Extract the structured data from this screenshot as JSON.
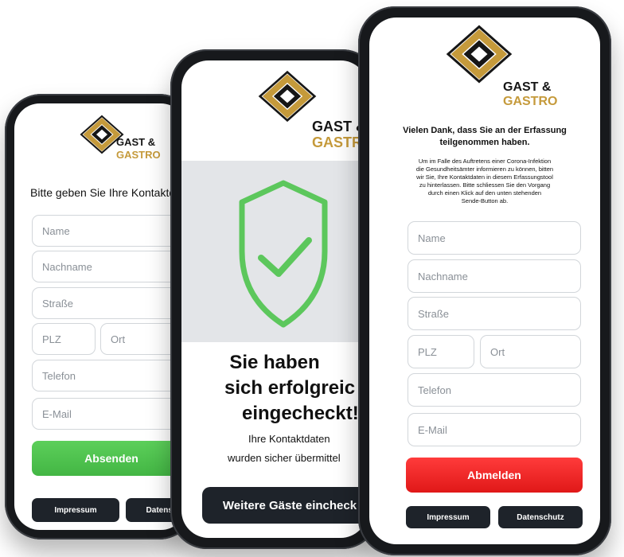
{
  "brand": {
    "line1": "GAST &",
    "line2": "GASTRO",
    "gold": "#c59a3b",
    "dark": "#161616"
  },
  "colors": {
    "green": "#4cc04b",
    "red": "#ee2424",
    "dark_button": "#1e232a",
    "shield": "#5cc75c"
  },
  "left": {
    "prompt": "Bitte geben Sie Ihre Kontaktda",
    "fields": {
      "name": "Name",
      "nachname": "Nachname",
      "strasse": "Straße",
      "plz": "PLZ",
      "ort": "Ort",
      "telefon": "Telefon",
      "email": "E-Mail"
    },
    "submit": "Absenden",
    "impressum": "Impressum",
    "datenschutz": "Datensc"
  },
  "middle": {
    "heading_line1": "Sie haben",
    "heading_line2": "sich erfolgreic",
    "heading_line3": "eingecheckt!",
    "sub_line1": "Ihre Kontaktdaten",
    "sub_line2": "wurden sicher übermittel",
    "more_guests": "Weitere Gäste eincheck"
  },
  "right": {
    "thanks_line1": "Vielen Dank, dass Sie an der Erfassung",
    "thanks_line2": "teilgenommen haben.",
    "info_lines": [
      "Um im Falle des Auftretens einer Corona-Infektion",
      "die Gesundheitsämter informieren zu können, bitten",
      "wir Sie, Ihre Kontaktdaten in diesem Erfassungstool",
      "zu hinterlassen. Bitte schliessen Sie den Vorgang",
      "durch einen Klick auf den unten stehenden",
      "Sende-Button ab."
    ],
    "fields": {
      "name": "Name",
      "nachname": "Nachname",
      "strasse": "Straße",
      "plz": "PLZ",
      "ort": "Ort",
      "telefon": "Telefon",
      "email": "E-Mail"
    },
    "logout": "Abmelden",
    "impressum": "Impressum",
    "datenschutz": "Datenschutz"
  }
}
